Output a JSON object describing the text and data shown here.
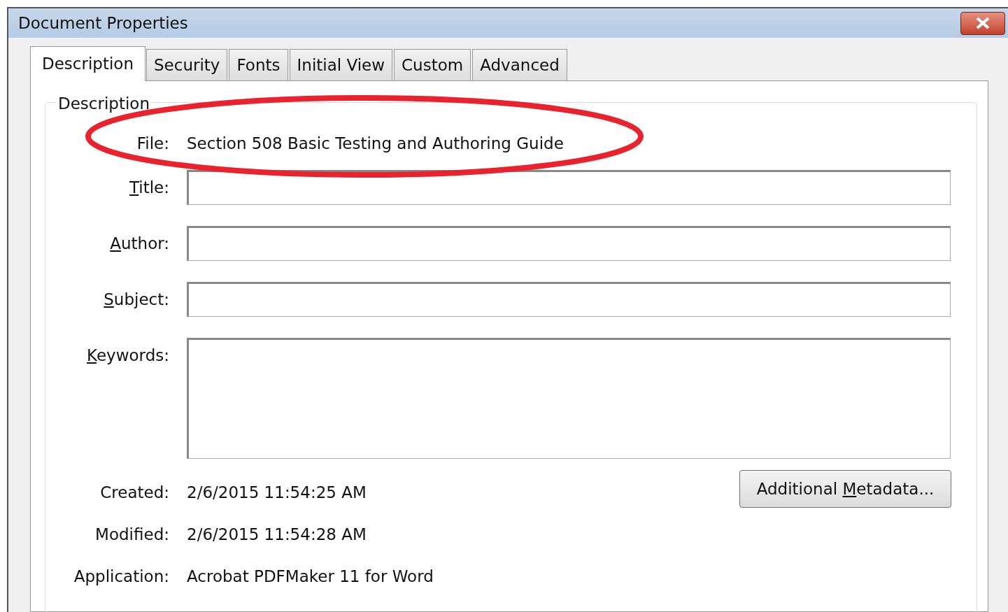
{
  "window": {
    "title": "Document Properties"
  },
  "tabs": [
    {
      "label": "Description",
      "selected": true
    },
    {
      "label": "Security",
      "selected": false
    },
    {
      "label": "Fonts",
      "selected": false
    },
    {
      "label": "Initial View",
      "selected": false
    },
    {
      "label": "Custom",
      "selected": false
    },
    {
      "label": "Advanced",
      "selected": false
    }
  ],
  "group": {
    "title": "Description",
    "file": {
      "label": "File:",
      "value": "Section 508 Basic Testing and Authoring Guide",
      "highlighted": true
    },
    "fields": [
      {
        "kind": "line",
        "access_key": "T",
        "label_after": "itle:"
      },
      {
        "kind": "line",
        "access_key": "A",
        "label_after": "uthor:"
      },
      {
        "kind": "line",
        "access_key": "S",
        "label_after": "ubject:"
      },
      {
        "kind": "multiline",
        "access_key": "K",
        "label_after": "eywords:"
      }
    ],
    "info": [
      {
        "label": "Created:",
        "value": "2/6/2015 11:54:25 AM"
      },
      {
        "label": "Modified:",
        "value": "2/6/2015 11:54:28 AM"
      },
      {
        "label": "Application:",
        "value": "Acrobat PDFMaker 11 for Word"
      }
    ],
    "metadata_button": {
      "label_before": "Additional ",
      "access_key": "M",
      "label_after": "etadata..."
    }
  }
}
